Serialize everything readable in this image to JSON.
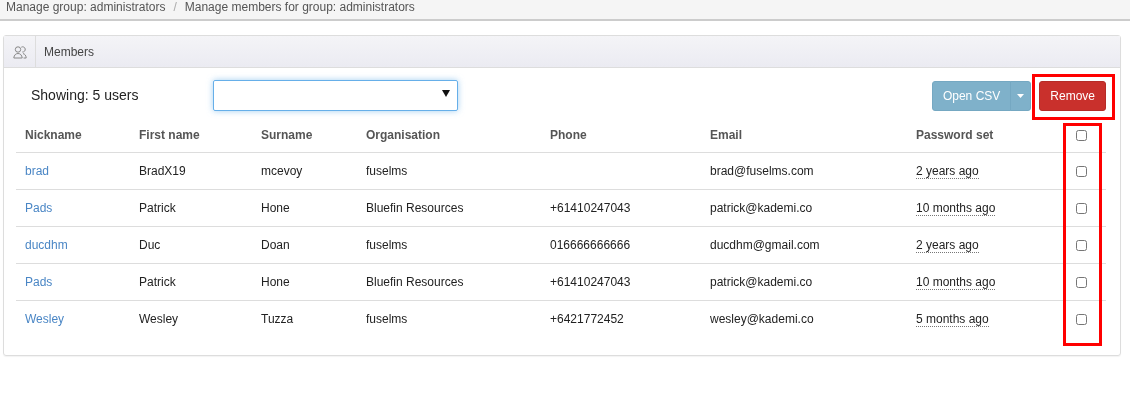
{
  "breadcrumb": [
    {
      "label": "Manage group: administrators"
    },
    {
      "label": "Manage members for group: administrators"
    }
  ],
  "breadcrumb_separator": "/",
  "panel": {
    "title": "Members"
  },
  "toolbar": {
    "showing": "Showing: 5 users",
    "open_csv": "Open CSV",
    "remove": "Remove"
  },
  "table": {
    "columns": [
      "Nickname",
      "First name",
      "Surname",
      "Organisation",
      "Phone",
      "Email",
      "Password set"
    ],
    "select_all_checked": false,
    "rows": [
      {
        "nickname": "brad",
        "first_name": "BradX19",
        "surname": "mcevoy",
        "organisation": "fuselms",
        "phone": "",
        "email": "brad@fuselms.com",
        "password_set": "2 years ago",
        "checked": false
      },
      {
        "nickname": "Pads",
        "first_name": "Patrick",
        "surname": "Hone",
        "organisation": "Bluefin Resources",
        "phone": "+61410247043",
        "email": "patrick@kademi.co",
        "password_set": "10 months ago",
        "checked": false
      },
      {
        "nickname": "ducdhm",
        "first_name": "Duc",
        "surname": "Doan",
        "organisation": "fuselms",
        "phone": "016666666666",
        "email": "ducdhm@gmail.com",
        "password_set": "2 years ago",
        "checked": false
      },
      {
        "nickname": "Pads",
        "first_name": "Patrick",
        "surname": "Hone",
        "organisation": "Bluefin Resources",
        "phone": "+61410247043",
        "email": "patrick@kademi.co",
        "password_set": "10 months ago",
        "checked": false
      },
      {
        "nickname": "Wesley",
        "first_name": "Wesley",
        "surname": "Tuzza",
        "organisation": "fuselms",
        "phone": "+6421772452",
        "email": "wesley@kademi.co",
        "password_set": "5 months ago",
        "checked": false
      }
    ]
  },
  "highlights": {
    "remove_button": true,
    "checkbox_column": true
  }
}
